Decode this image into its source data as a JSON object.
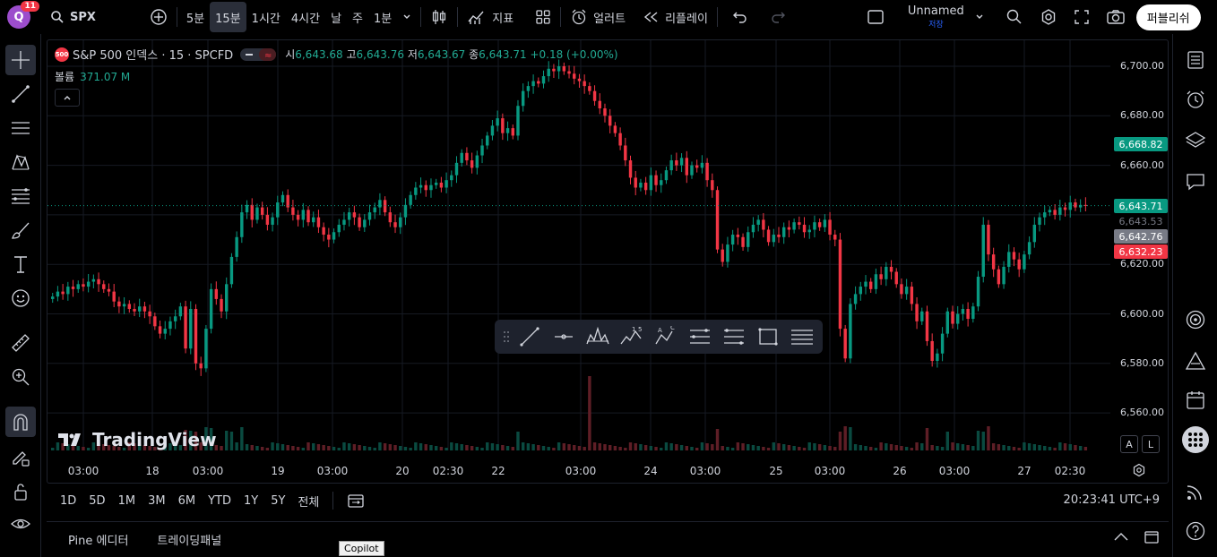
{
  "topbar": {
    "avatar_letter": "Q",
    "notifications": "11",
    "symbol": "SPX",
    "intervals": [
      "5분",
      "15분",
      "1시간",
      "4시간",
      "날",
      "주",
      "1분"
    ],
    "active_interval": "15분",
    "indicators_label": "지표",
    "alert_label": "얼러트",
    "replay_label": "리플레이",
    "layout_name": "Unnamed",
    "layout_status": "저장",
    "publish_label": "퍼블리쉬"
  },
  "legend": {
    "logo_text": "500",
    "title": "S&P 500 인덱스 · 15 · SPCFD",
    "open_label": "시",
    "open": "6,643.68",
    "high_label": "고",
    "high": "6,643.76",
    "low_label": "저",
    "low": "6,643.67",
    "close_label": "종",
    "close": "6,643.71",
    "change": "+0.18 (+0.00%)",
    "volume_label": "볼륨",
    "volume": "371.07 M"
  },
  "price_axis": {
    "labels": [
      "6,700.00",
      "6,680.00",
      "6,660.00",
      "6,620.00",
      "6,600.00",
      "6,580.00",
      "6,560.00"
    ],
    "tags": [
      {
        "text": "6,668.82",
        "color": "#089981"
      },
      {
        "text": "6,643.71",
        "color": "#089981"
      },
      {
        "text": "6,643.53",
        "color": "transparent"
      },
      {
        "text": "6,642.76",
        "color": "#787b86"
      },
      {
        "text": "6,632.23",
        "color": "#f23645"
      }
    ]
  },
  "time_axis": {
    "labels": [
      "03:00",
      "18",
      "03:00",
      "19",
      "03:00",
      "20",
      "02:30",
      "22",
      "03:00",
      "24",
      "03:00",
      "25",
      "03:00",
      "26",
      "03:00",
      "27",
      "02:30"
    ]
  },
  "watermark": "TradingView",
  "scale_buttons": {
    "auto": "A",
    "log": "L"
  },
  "range_bar": {
    "ranges": [
      "1D",
      "5D",
      "1M",
      "3M",
      "6M",
      "YTD",
      "1Y",
      "5Y",
      "전체"
    ],
    "clock": "20:23:41 UTC+9"
  },
  "bottom_panel": {
    "tabs": [
      "Pine 에디터",
      "트레이딩패널"
    ]
  },
  "tooltip": "Copilot",
  "chart_data": {
    "type": "candlestick",
    "title": "S&P 500 인덱스 · 15 · SPCFD",
    "ylim": [
      6550,
      6705
    ],
    "closes": [
      6607,
      6609,
      6608,
      6611,
      6610,
      6612,
      6611,
      6613,
      6614,
      6612,
      6610,
      6609,
      6605,
      6603,
      6604,
      6602,
      6601,
      6603,
      6601,
      6599,
      6595,
      6592,
      6594,
      6597,
      6599,
      6603,
      6586,
      6602,
      6580,
      6578,
      6594,
      6610,
      6606,
      6601,
      6612,
      6623,
      6631,
      6641,
      6644,
      6638,
      6643,
      6640,
      6636,
      6639,
      6645,
      6648,
      6643,
      6640,
      6638,
      6642,
      6637,
      6639,
      6635,
      6632,
      6630,
      6633,
      6636,
      6638,
      6641,
      6639,
      6635,
      6638,
      6641,
      6643,
      6646,
      6641,
      6637,
      6635,
      6639,
      6644,
      6648,
      6651,
      6652,
      6650,
      6652,
      6653,
      6651,
      6654,
      6656,
      6661,
      6665,
      6662,
      6659,
      6664,
      6668,
      6672,
      6676,
      6679,
      6673,
      6675,
      6672,
      6684,
      6690,
      6692,
      6694,
      6693,
      6696,
      6699,
      6698,
      6700,
      6698,
      6697,
      6695,
      6694,
      6692,
      6690,
      6686,
      6683,
      6680,
      6676,
      6673,
      6668,
      6662,
      6655,
      6651,
      6653,
      6650,
      6656,
      6652,
      6654,
      6658,
      6662,
      6660,
      6663,
      6656,
      6660,
      6659,
      6661,
      6654,
      6650,
      6626,
      6621,
      6628,
      6632,
      6631,
      6627,
      6633,
      6636,
      6638,
      6634,
      6629,
      6632,
      6631,
      6635,
      6634,
      6637,
      6636,
      6633,
      6634,
      6637,
      6635,
      6638,
      6632,
      6630,
      6594,
      6582,
      6604,
      6608,
      6611,
      6613,
      6610,
      6616,
      6614,
      6619,
      6617,
      6612,
      6608,
      6611,
      6604,
      6597,
      6601,
      6589,
      6581,
      6584,
      6592,
      6601,
      6596,
      6600,
      6602,
      6598,
      6603,
      6615,
      6636,
      6624,
      6618,
      6612,
      6619,
      6625,
      6622,
      6618,
      6624,
      6629,
      6636,
      6639,
      6641,
      6642,
      6640,
      6643,
      6642,
      6645,
      6643,
      6644,
      6643.71
    ],
    "x_labels": [
      "03:00",
      "18",
      "03:00",
      "19",
      "03:00",
      "20",
      "02:30",
      "22",
      "03:00",
      "24",
      "03:00",
      "25",
      "03:00",
      "26",
      "03:00",
      "27",
      "02:30"
    ],
    "grid": true
  }
}
